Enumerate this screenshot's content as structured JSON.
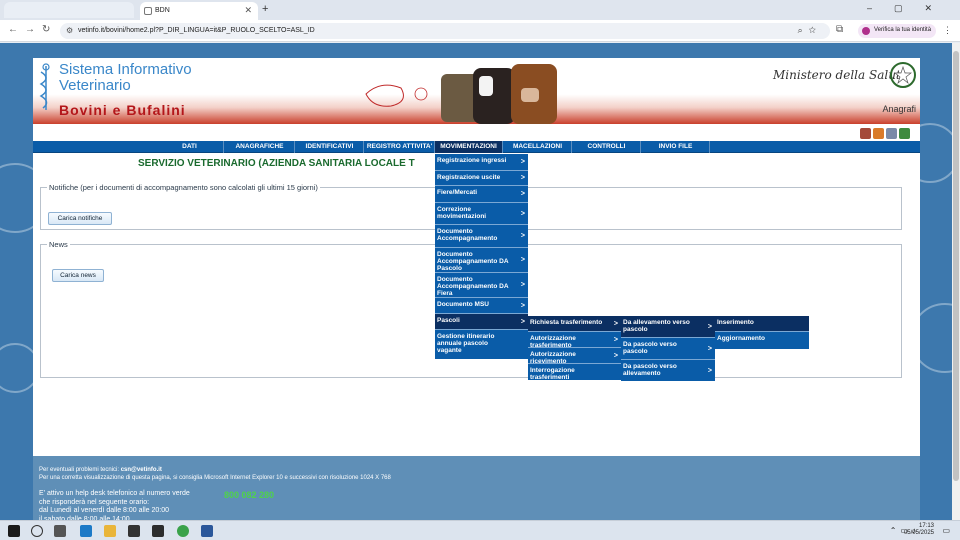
{
  "browser": {
    "tab_title": "BDN",
    "url": "vetinfo.it/bovini/home2.pl?P_DIR_LINGUA=it&P_RUOLO_SCELTO=ASL_ID",
    "verify_label": "Verifica la tua identità"
  },
  "header": {
    "title_line1": "Sistema Informativo",
    "title_line2": "Veterinario",
    "subtitle": "Bovini e Bufalini",
    "ministero": "Ministero della Salute",
    "anagrafi": "Anagrafi"
  },
  "nav": {
    "items": [
      "DATI",
      "ANAGRAFICHE",
      "IDENTIFICATIVI",
      "REGISTRO ATTIVITA'",
      "MOVIMENTAZIONI",
      "MACELLAZIONI",
      "CONTROLLI",
      "INVIO FILE"
    ]
  },
  "main": {
    "service_title": "SERVIZIO VETERINARIO (AZIENDA SANITARIA LOCALE T",
    "notifiche_legend": "Notifiche (per i documenti di accompagnamento sono calcolati gli ultimi 15 giorni)",
    "carica_notifiche": "Carica notifiche",
    "news_legend": "News",
    "carica_news": "Carica news"
  },
  "menu_mov": {
    "items": [
      "Registrazione ingressi",
      "Registrazione uscite",
      "Fiere/Mercati",
      "Correzione movimentazioni",
      "Documento Accompagnamento",
      "Documento Accompagnamento DA Pascolo",
      "Documento Accompagnamento DA Fiera",
      "Documento MSU",
      "Pascoli",
      "Gestione itinerario annuale pascolo vagante"
    ],
    "arrow": ">"
  },
  "menu_pascoli": {
    "items": [
      "Richiesta trasferimento",
      "Autorizzazione trasferimento",
      "Autorizzazione ricevimento",
      "Interrogazione trasferimenti"
    ]
  },
  "menu_richiesta": {
    "items": [
      "Da allevamento verso pascolo",
      "Da pascolo verso pascolo",
      "Da pascolo verso allevamento"
    ]
  },
  "menu_allevamento": {
    "items": [
      "Inserimento",
      "Aggiornamento"
    ]
  },
  "footer": {
    "problems_prefix": "Per eventuali problemi tecnici: ",
    "problems_email": "csn@vetinfo.it",
    "resolution": "Per una corretta visualizzazione di questa pagina, si consiglia Microsoft Internet Explorer 10 e successivi con risoluzione 1024 X 768",
    "help_line1": "E' attivo un help desk telefonico al numero verde",
    "help_line2": "che risponderà nel seguente orario:",
    "help_line3": "dal Lunedì al venerdì dalle 8:00 alle 20:00",
    "help_line4": "il sabato dalle 8:00 alle 14:00",
    "phone": "800 082 280"
  },
  "taskbar": {
    "time": "17:13",
    "date": "05/05/2025"
  }
}
